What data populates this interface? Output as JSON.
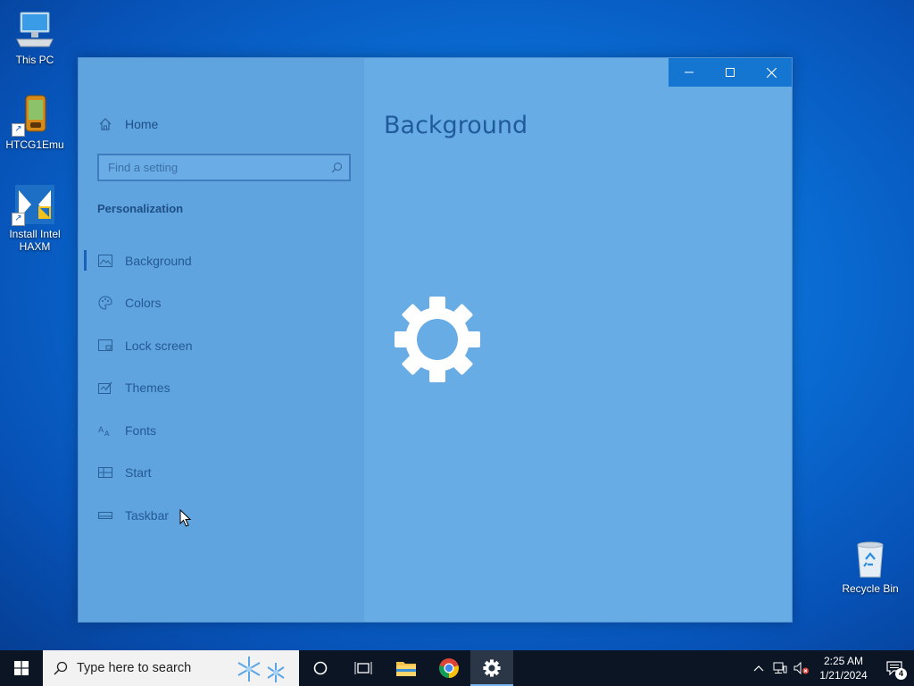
{
  "desktop": {
    "icons": [
      {
        "label": "This PC"
      },
      {
        "label": "HTCG1Emu"
      },
      {
        "label": "Install Intel HAXM"
      },
      {
        "label": "Recycle Bin"
      }
    ]
  },
  "window": {
    "sidebar": {
      "home_label": "Home",
      "search_placeholder": "Find a setting",
      "section_title": "Personalization",
      "items": [
        {
          "label": "Background",
          "icon": "picture-icon",
          "selected": true
        },
        {
          "label": "Colors",
          "icon": "palette-icon"
        },
        {
          "label": "Lock screen",
          "icon": "lock-screen-icon"
        },
        {
          "label": "Themes",
          "icon": "themes-icon"
        },
        {
          "label": "Fonts",
          "icon": "fonts-icon"
        },
        {
          "label": "Start",
          "icon": "start-icon"
        },
        {
          "label": "Taskbar",
          "icon": "taskbar-icon"
        }
      ]
    },
    "main": {
      "title": "Background"
    },
    "controls": {
      "minimize": "minimize-icon",
      "maximize": "maximize-icon",
      "close": "close-icon"
    },
    "colors": {
      "sidebar_bg": "#5fa3df",
      "main_bg": "#68ace6",
      "controls_bg": "#1476d0"
    }
  },
  "taskbar": {
    "search_placeholder": "Type here to search",
    "clock_time": "2:25 AM",
    "clock_date": "1/21/2024",
    "notification_count": "4"
  }
}
